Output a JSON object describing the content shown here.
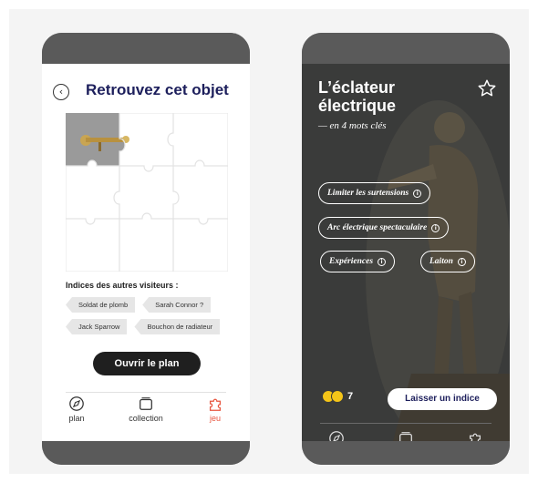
{
  "left": {
    "title": "Retrouvez cet objet",
    "back_symbol": "‹",
    "hints_label": "Indices des autres visiteurs :",
    "hints": [
      "Soldat de plomb",
      "Sarah Connor ?",
      "Jack Sparrow",
      "Bouchon de radiateur"
    ],
    "open_plan_label": "Ouvrir le plan",
    "nav": {
      "plan": "plan",
      "collection": "collection",
      "jeu": "jeu"
    }
  },
  "right": {
    "title_line1": "L’éclateur",
    "title_line2": "électrique",
    "subtitle": "— en 4 mots clés",
    "info_symbol": "i",
    "keywords": [
      "Limiter les surtensions",
      "Arc électrique spectaculaire",
      "Expériences",
      "Laiton"
    ],
    "reactions_count": "7",
    "leave_hint_label": "Laisser un indice",
    "nav": {
      "plan": "plan",
      "collection": "collection",
      "jeu": "jeu"
    }
  },
  "colors": {
    "title_navy": "#1d1f5c",
    "active_tab": "#e8553f",
    "button_dark": "#1f1f1f",
    "right_bg": "#3a3b3a"
  },
  "icons": {
    "back": "chevron-left-icon",
    "plan": "compass-icon",
    "collection": "collection-icon",
    "jeu": "puzzle-icon",
    "favorite": "star-icon",
    "info": "info-icon",
    "reactions": "emoji-icon"
  },
  "puzzle": {
    "pieces_total": 9,
    "pieces_found": 1
  }
}
